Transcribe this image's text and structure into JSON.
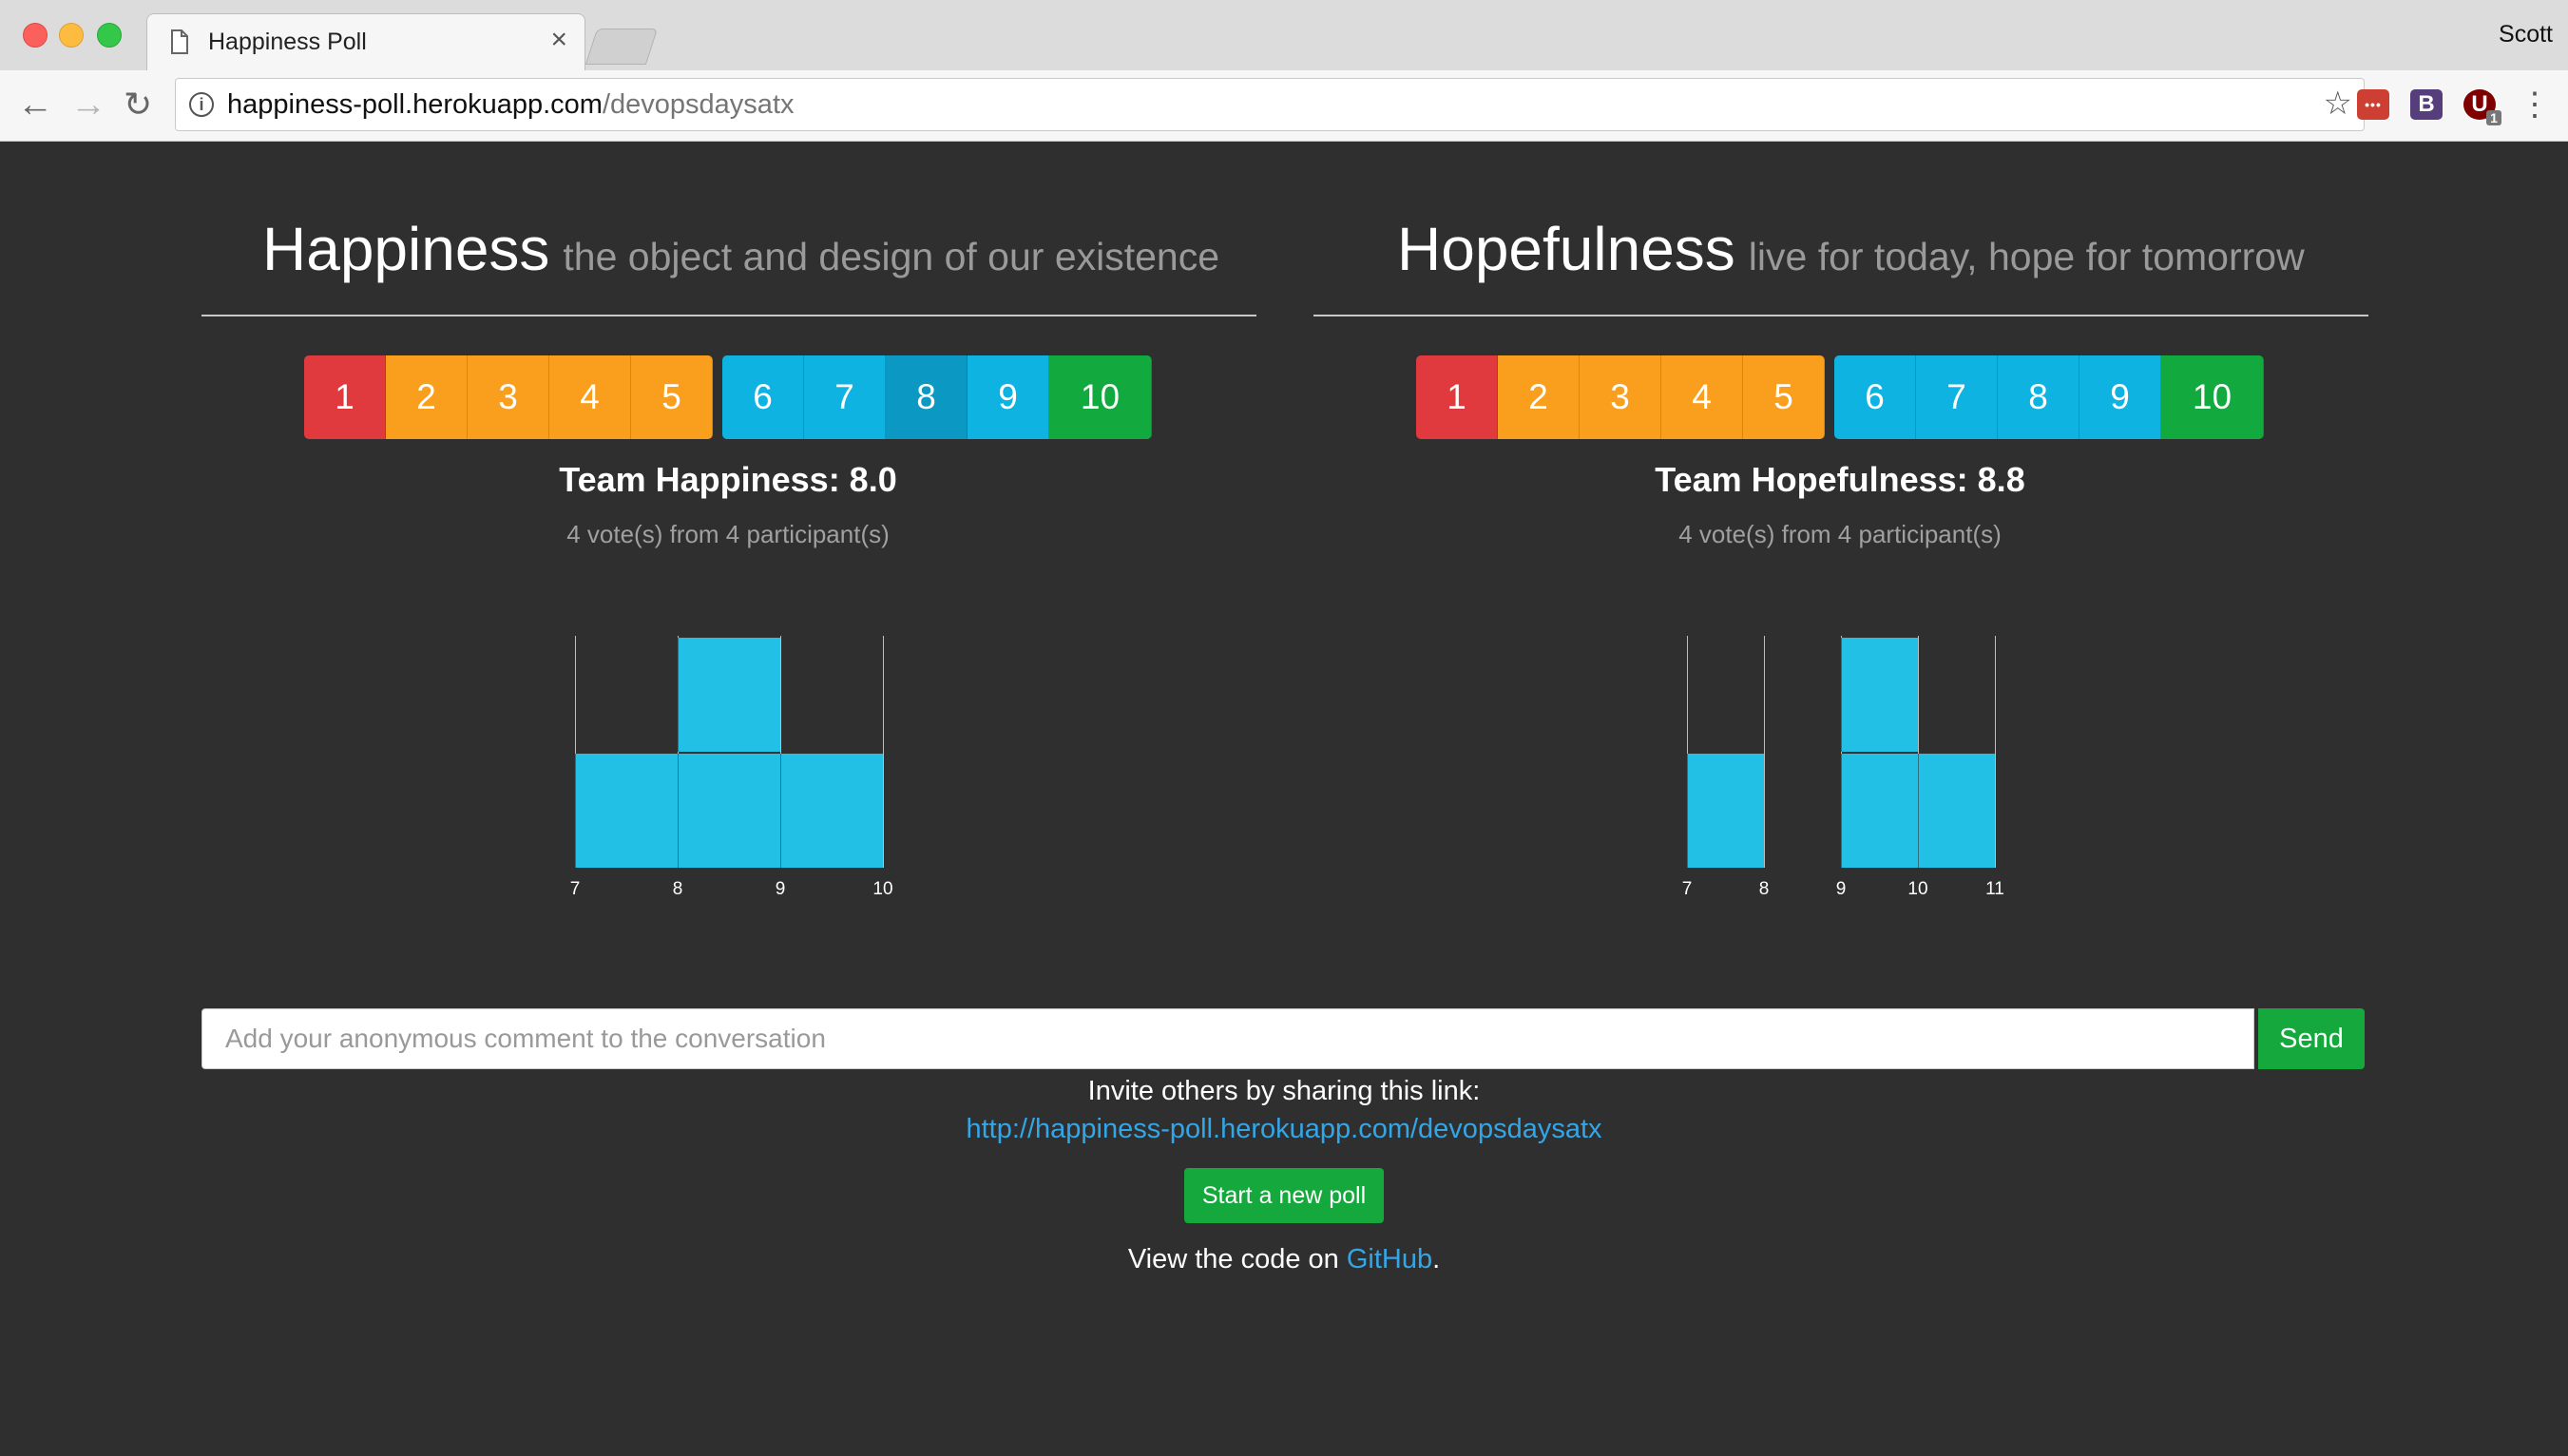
{
  "browser": {
    "tab_title": "Happiness Poll",
    "tab_close": "×",
    "profile_name": "Scott",
    "url_host": "happiness-poll.herokuapp.com",
    "url_path": "/devopsdaysatx",
    "extensions": [
      {
        "name": "lastpass-extension-icon",
        "color": "#cc3f32",
        "glyph": "•••"
      },
      {
        "name": "bootstrap-extension-icon",
        "color": "#563d7c",
        "glyph": "B"
      },
      {
        "name": "ublock-extension-icon",
        "color": "#800000",
        "glyph": "U",
        "badge": "1"
      }
    ]
  },
  "colors": {
    "page_bg": "#2f2f2f",
    "red": "#e03a3e",
    "orange": "#f99e1d",
    "blue": "#0fb3e2",
    "green": "#12a93f",
    "link": "#33a6e8",
    "bar": "#23c0e6"
  },
  "happiness": {
    "title": "Happiness",
    "subtitle": "the object and design of our existence",
    "scale": [
      "1",
      "2",
      "3",
      "4",
      "5",
      "6",
      "7",
      "8",
      "9",
      "10"
    ],
    "selected": "8",
    "team_label": "Team Happiness: 8.0",
    "votes_text": "4 vote(s) from 4 participant(s)"
  },
  "hopefulness": {
    "title": "Hopefulness",
    "subtitle": "live for today, hope for tomorrow",
    "scale": [
      "1",
      "2",
      "3",
      "4",
      "5",
      "6",
      "7",
      "8",
      "9",
      "10"
    ],
    "team_label": "Team Hopefulness: 8.8",
    "votes_text": "4 vote(s) from 4 participant(s)"
  },
  "chart_data": [
    {
      "type": "bar",
      "title": "",
      "categories": [
        "7",
        "8",
        "9",
        "10"
      ],
      "values": [
        1,
        2,
        1
      ],
      "ylim": [
        0,
        2
      ]
    },
    {
      "type": "bar",
      "title": "",
      "categories": [
        "7",
        "8",
        "9",
        "10",
        "11"
      ],
      "values": [
        1,
        0,
        2,
        1
      ],
      "ylim": [
        0,
        2
      ]
    }
  ],
  "comment": {
    "placeholder": "Add your anonymous comment to the conversation",
    "send_label": "Send"
  },
  "invite_text": "Invite others by sharing this link:",
  "invite_link": "http://happiness-poll.herokuapp.com/devopsdaysatx",
  "new_poll_label": "Start a new poll",
  "view_code_prefix": "View the code on",
  "view_code_link": "GitHub",
  "view_code_suffix": "."
}
